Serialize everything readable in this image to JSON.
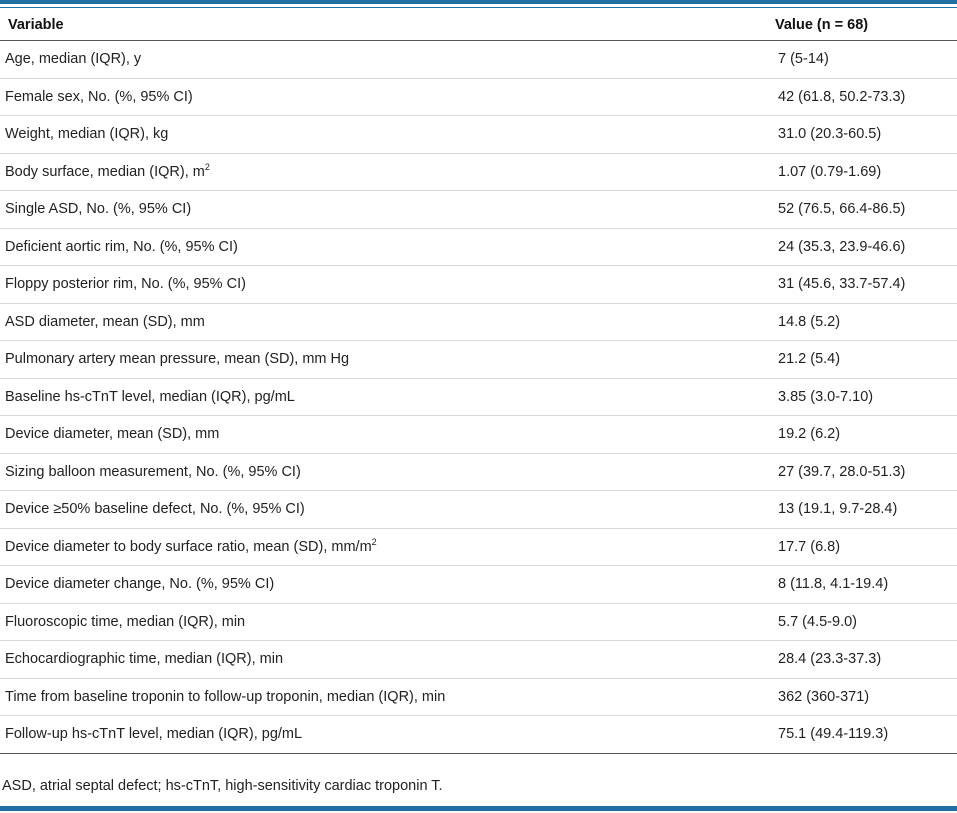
{
  "table": {
    "headers": {
      "variable": "Variable",
      "value": "Value (n = 68)"
    },
    "rows": [
      {
        "label": "Age, median (IQR), y",
        "value": "7 (5-14)"
      },
      {
        "label": "Female sex, No. (%, 95% CI)",
        "value": "42 (61.8, 50.2-73.3)"
      },
      {
        "label": "Weight, median (IQR), kg",
        "value": "31.0 (20.3-60.5)"
      },
      {
        "label": "Body surface, median (IQR), m",
        "sup": "2",
        "value": "1.07 (0.79-1.69)"
      },
      {
        "label": "Single ASD, No. (%, 95% CI)",
        "value": "52 (76.5, 66.4-86.5)"
      },
      {
        "label": "Deficient aortic rim, No. (%, 95% CI)",
        "value": "24 (35.3, 23.9-46.6)"
      },
      {
        "label": "Floppy posterior rim, No. (%, 95% CI)",
        "value": "31 (45.6, 33.7-57.4)"
      },
      {
        "label": "ASD diameter, mean (SD), mm",
        "value": "14.8 (5.2)"
      },
      {
        "label": "Pulmonary artery mean pressure, mean (SD), mm Hg",
        "value": "21.2 (5.4)"
      },
      {
        "label": "Baseline hs-cTnT level, median (IQR), pg/mL",
        "value": "3.85 (3.0-7.10)"
      },
      {
        "label": "Device diameter, mean (SD), mm",
        "value": "19.2 (6.2)"
      },
      {
        "label": "Sizing balloon measurement, No. (%, 95% CI)",
        "value": "27 (39.7, 28.0-51.3)"
      },
      {
        "label": "Device ≥50% baseline defect, No. (%, 95% CI)",
        "value": "13 (19.1, 9.7-28.4)"
      },
      {
        "label": "Device diameter to body surface ratio, mean (SD), mm/m",
        "sup": "2",
        "value": "17.7 (6.8)"
      },
      {
        "label": "Device diameter change, No. (%, 95% CI)",
        "value": "8 (11.8, 4.1-19.4)"
      },
      {
        "label": "Fluoroscopic time, median (IQR), min",
        "value": "5.7 (4.5-9.0)"
      },
      {
        "label": "Echocardiographic time, median (IQR), min",
        "value": "28.4 (23.3-37.3)"
      },
      {
        "label": "Time from baseline troponin to follow-up troponin, median (IQR), min",
        "value": "362 (360-371)"
      },
      {
        "label": "Follow-up hs-cTnT level, median (IQR), pg/mL",
        "value": "75.1 (49.4-119.3)"
      }
    ]
  },
  "footnote": "ASD, atrial septal defect; hs-cTnT, high-sensitivity cardiac troponin T.",
  "colors": {
    "accent_rule": "#1f6fa5"
  }
}
